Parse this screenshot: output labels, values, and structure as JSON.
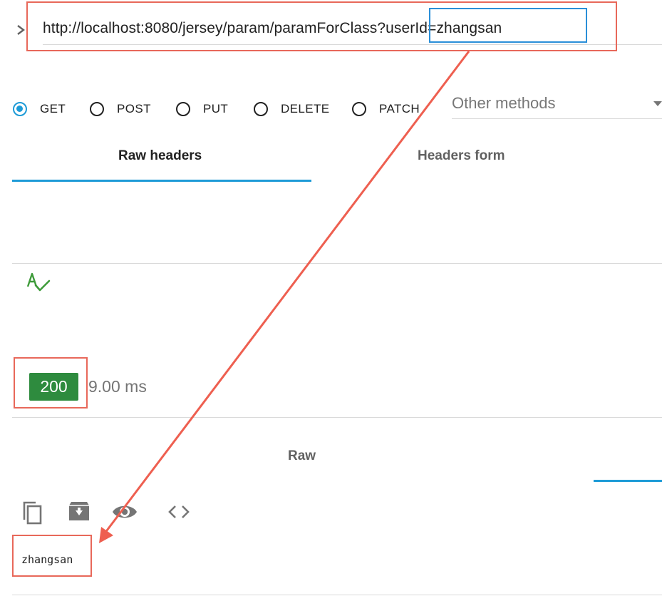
{
  "request": {
    "url": "http://localhost:8080/jersey/param/paramForClass?userId=zhangsan"
  },
  "methods": [
    {
      "label": "GET",
      "selected": true
    },
    {
      "label": "POST",
      "selected": false
    },
    {
      "label": "PUT",
      "selected": false
    },
    {
      "label": "DELETE",
      "selected": false
    },
    {
      "label": "PATCH",
      "selected": false
    }
  ],
  "other_methods_label": "Other methods",
  "header_tabs": [
    {
      "label": "Raw headers",
      "active": true
    },
    {
      "label": "Headers form",
      "active": false
    }
  ],
  "response": {
    "status_code": "200",
    "timing": "9.00 ms",
    "view_tab": "Raw",
    "body": "zhangsan"
  },
  "toolbar_icons": [
    "copy-icon",
    "save-icon",
    "eye-icon",
    "code-icon"
  ],
  "colors": {
    "accent": "#1e9bd7",
    "status_ok": "#2e8b3e",
    "annotation": "#e8685a",
    "annotation_blue": "#2a8fd8"
  }
}
